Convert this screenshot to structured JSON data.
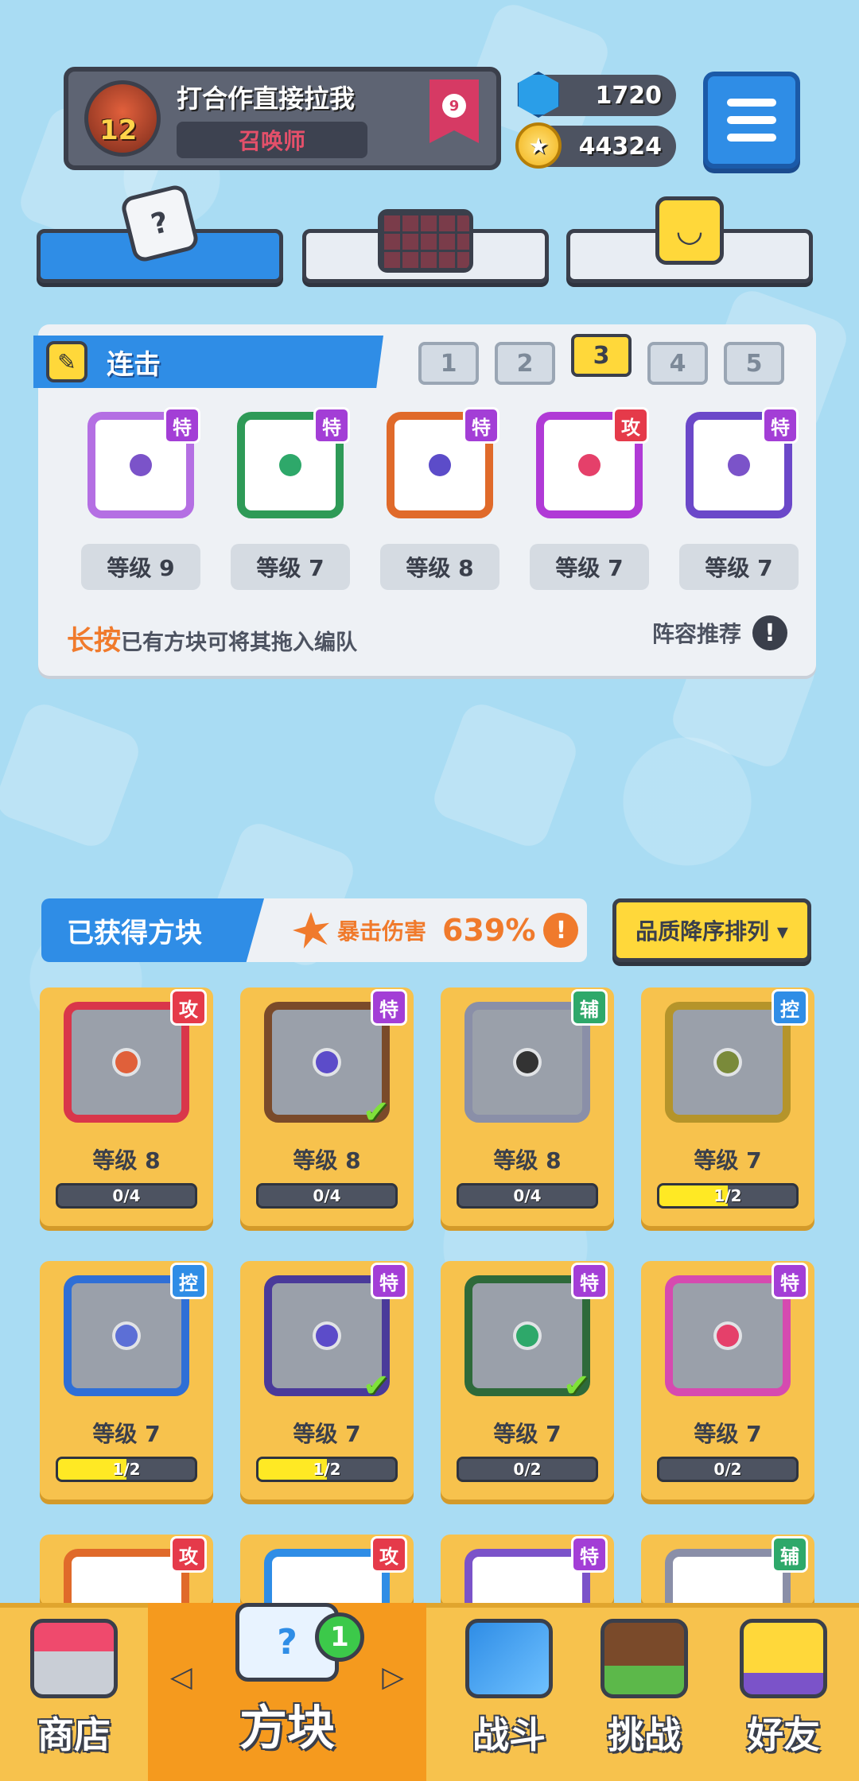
{
  "player": {
    "name": "打合作直接拉我",
    "title": "召唤师",
    "level": "12",
    "rank": "9"
  },
  "currency": {
    "gems": "1720",
    "gold": "44324"
  },
  "deck": {
    "title": "连击",
    "slots": [
      "1",
      "2",
      "3",
      "4",
      "5"
    ],
    "active_slot": "3",
    "dice": [
      {
        "type": "特",
        "level": "等级 9",
        "color": "#b46fe3",
        "dot": "#7b53c9"
      },
      {
        "type": "特",
        "level": "等级 7",
        "color": "#2e9a57",
        "dot": "#2ea86a"
      },
      {
        "type": "特",
        "level": "等级 8",
        "color": "#e06a2a",
        "dot": "#5c4cc9"
      },
      {
        "type": "攻",
        "level": "等级 7",
        "color": "#b03ad6",
        "dot": "#e5406a"
      },
      {
        "type": "特",
        "level": "等级 7",
        "color": "#6b48c9",
        "dot": "#7b53c9"
      }
    ],
    "hint_strong": "长按",
    "hint_text": "已有方块可将其拖入编队",
    "recommend": "阵容推荐",
    "recommend_icon": "!"
  },
  "owned": {
    "title": "已获得方块",
    "crit_label": "暴击伤害",
    "crit_value": "639%",
    "crit_icon": "!",
    "sort_label": "品质降序排列 ▾",
    "cards": [
      {
        "type": "攻",
        "level": "等级 8",
        "progress": "0/4",
        "fill": 0,
        "color": "#d9364a",
        "dot": "#e0603a",
        "check": false
      },
      {
        "type": "特",
        "level": "等级 8",
        "progress": "0/4",
        "fill": 0,
        "color": "#7a4a2a",
        "dot": "#5c4cc9",
        "check": true
      },
      {
        "type": "辅",
        "level": "等级 8",
        "progress": "0/4",
        "fill": 0,
        "color": "#8a8fa8",
        "dot": "#333333",
        "check": false
      },
      {
        "type": "控",
        "level": "等级 7",
        "progress": "1/2",
        "fill": 0.5,
        "color": "#b5942a",
        "dot": "#7a8a3a",
        "check": false
      },
      {
        "type": "控",
        "level": "等级 7",
        "progress": "1/2",
        "fill": 0.5,
        "color": "#2f6fd6",
        "dot": "#5c6fd6",
        "check": false
      },
      {
        "type": "特",
        "level": "等级 7",
        "progress": "1/2",
        "fill": 0.5,
        "color": "#4a3a9a",
        "dot": "#5c4cc9",
        "check": true
      },
      {
        "type": "特",
        "level": "等级 7",
        "progress": "0/2",
        "fill": 0,
        "color": "#2e6a3a",
        "dot": "#2ea86a",
        "check": true
      },
      {
        "type": "特",
        "level": "等级 7",
        "progress": "0/2",
        "fill": 0,
        "color": "#d64ab0",
        "dot": "#e5406a",
        "check": false
      }
    ],
    "peek_types": [
      "攻",
      "攻",
      "特",
      "辅"
    ]
  },
  "nav": {
    "shop": "商店",
    "blocks": "方块",
    "battle": "战斗",
    "challenge": "挑战",
    "friends": "好友",
    "blocks_badge": "1"
  },
  "icons": {
    "menu": "hamburger-menu-icon",
    "edit": "pencil-icon",
    "gem": "gem-icon",
    "coin": "coin-icon"
  }
}
